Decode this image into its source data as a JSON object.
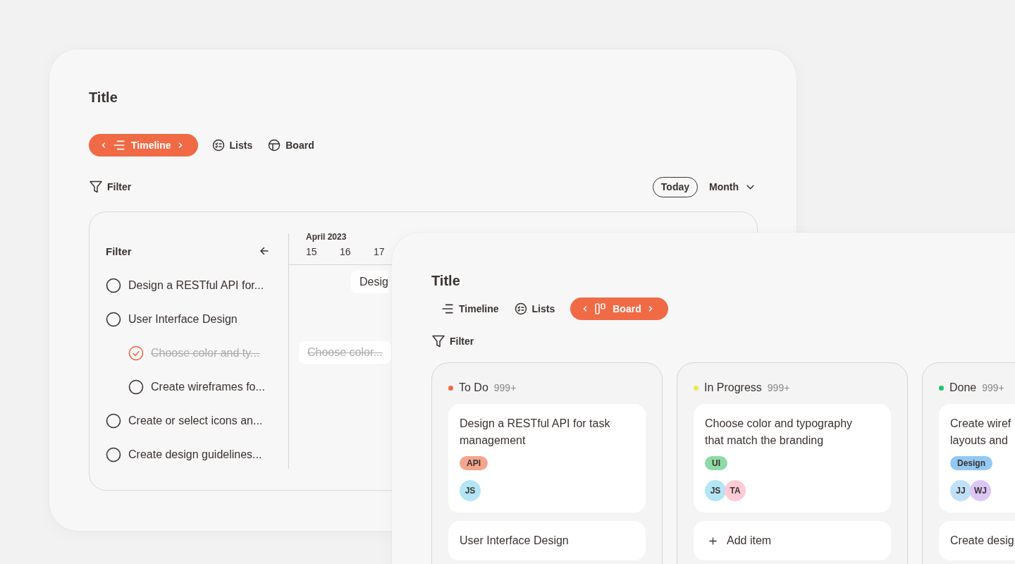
{
  "timeline_window": {
    "title": "Title",
    "tabs": [
      {
        "kind": "timeline",
        "label": "Timeline",
        "selected": true
      },
      {
        "kind": "lists",
        "label": "Lists",
        "selected": false
      },
      {
        "kind": "board",
        "label": "Board",
        "selected": false
      }
    ],
    "filter": "Filter",
    "today": "Today",
    "range": "Month",
    "filter_panel": {
      "title": "Filter",
      "tasks": [
        {
          "label": "Design a RESTful API for...",
          "checked": false,
          "bar": "Desig"
        },
        {
          "label": "User Interface Design",
          "checked": false,
          "children": [
            {
              "label": "Choose color and ty...",
              "checked": true,
              "bar": "Choose color..."
            },
            {
              "label": "Create wireframes fo...",
              "checked": false
            }
          ]
        },
        {
          "label": "Create or select icons an...",
          "checked": false
        },
        {
          "label": "Create design guidelines...",
          "checked": false
        }
      ]
    },
    "timeline": {
      "month": "April 2023",
      "days": [
        "15",
        "16",
        "17"
      ]
    }
  },
  "board_window": {
    "title": "Title",
    "tabs": [
      {
        "kind": "timeline",
        "label": "Timeline",
        "selected": false
      },
      {
        "kind": "lists",
        "label": "Lists",
        "selected": false
      },
      {
        "kind": "board",
        "label": "Board",
        "selected": true
      }
    ],
    "filter": "Filter",
    "columns": [
      {
        "name": "To Do",
        "count": "999+",
        "color": "#ef6a45",
        "cards": [
          {
            "kind": "task",
            "title_lines": [
              "Design a RESTful API for task",
              "management"
            ],
            "tags": [
              {
                "label": "API",
                "color": "#f4a58e"
              }
            ],
            "assignees": [
              {
                "initials": "JS",
                "color": "#b3e5f5"
              }
            ]
          },
          {
            "kind": "task",
            "title_lines": [
              "User Interface Design"
            ]
          }
        ]
      },
      {
        "name": "In Progress",
        "count": "999+",
        "color": "#ede84f",
        "cards": [
          {
            "kind": "task",
            "title_lines": [
              "Choose color and typography",
              "that match the branding"
            ],
            "tags": [
              {
                "label": "UI",
                "color": "#8edba6"
              }
            ],
            "assignees": [
              {
                "initials": "JS",
                "color": "#b3e5f5"
              },
              {
                "initials": "TA",
                "color": "#fdcad6"
              }
            ]
          },
          {
            "kind": "add",
            "label": "Add item"
          }
        ]
      },
      {
        "name": "Done",
        "count": "999+",
        "color": "#1ec46c",
        "cards": [
          {
            "kind": "task",
            "title_lines": [
              "Create wiref",
              "layouts and"
            ],
            "tags": [
              {
                "label": "Design",
                "color": "#93c8f3"
              }
            ],
            "assignees": [
              {
                "initials": "JJ",
                "color": "#bfe0f8"
              },
              {
                "initials": "WJ",
                "color": "#dcc6f5"
              }
            ]
          },
          {
            "kind": "task",
            "title_lines": [
              "Create desig"
            ]
          }
        ]
      }
    ]
  }
}
